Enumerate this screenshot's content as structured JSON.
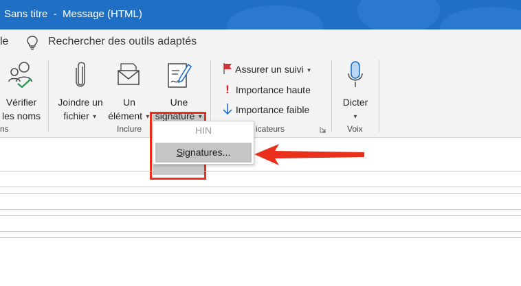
{
  "window": {
    "title": "Sans titre  -  Message (HTML)"
  },
  "search": {
    "tab_fragment": "le",
    "text": "Rechercher des outils adaptés"
  },
  "ribbon": {
    "names": {
      "line1": "Vérifier",
      "line2": "les noms",
      "group_fragment": "ns"
    },
    "include": {
      "attach_line1": "Joindre un",
      "attach_line2": "fichier",
      "element_line1": "Un",
      "element_line2": "élément",
      "signature_line1": "Une",
      "signature_line2": "signature",
      "group": "Inclure"
    },
    "tags": {
      "follow_up": "Assurer un suivi",
      "high": "Importance haute",
      "low": "Importance faible",
      "group_fragment": "icateurs"
    },
    "voice": {
      "dictate": "Dicter",
      "group": "Voix"
    }
  },
  "signature_menu": {
    "hin": "HIN",
    "signatures_underlined": "S",
    "signatures_rest": "ignatures..."
  },
  "colors": {
    "titlebar": "#1f6fc5",
    "highlight_border": "#e8301c",
    "arrow": "#e8301c",
    "flag": "#d13438",
    "importance_high": "#e81123",
    "importance_low": "#1f6fc5"
  }
}
